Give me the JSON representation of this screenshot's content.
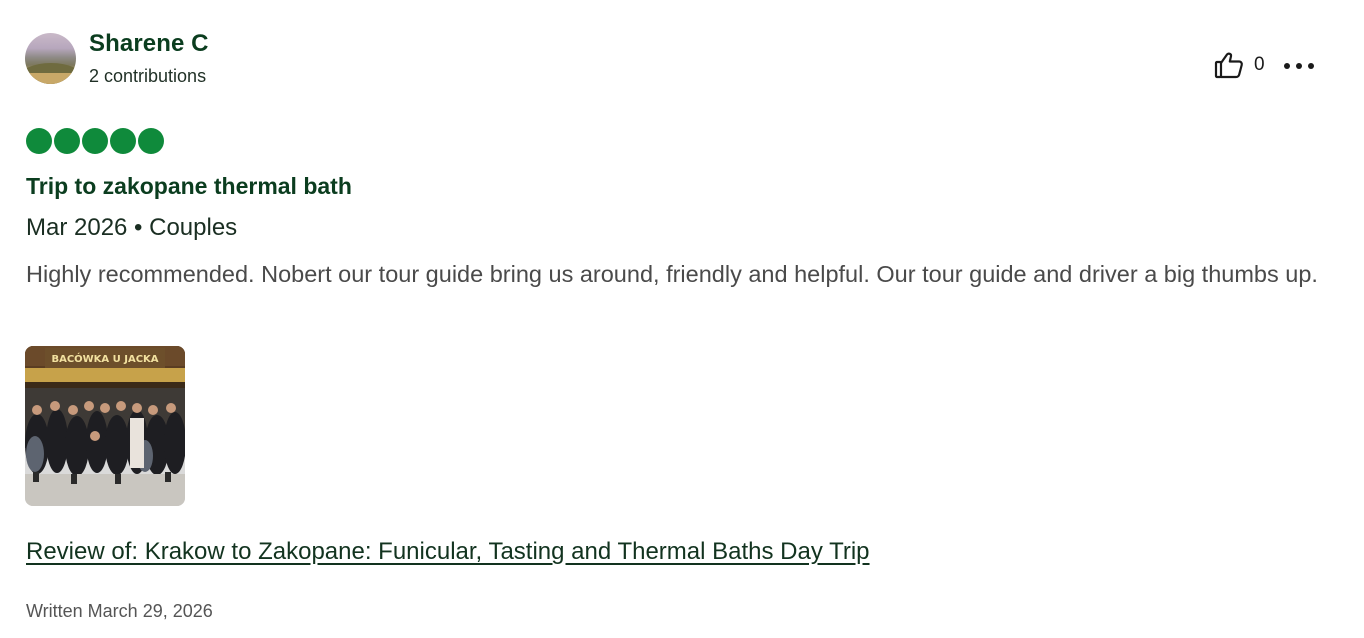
{
  "reviewer": {
    "name": "Sharene C",
    "contributions": "2 contributions"
  },
  "helpful": {
    "icon": "thumbs-up-icon",
    "count": "0"
  },
  "more_menu": {
    "icon": "more-dots-icon"
  },
  "rating": {
    "value": 5,
    "max": 5,
    "color": "#0f8a3b"
  },
  "review": {
    "title": "Trip to zakopane thermal bath",
    "meta": "Mar 2026 • Couples",
    "body": "Highly recommended. Nobert our tour guide bring us around, friendly and helpful. Our tour guide and driver a big thumbs up.",
    "photo_sign_text": "BACÓWKA U JACKA",
    "link_text": "Review of: Krakow to Zakopane: Funicular, Tasting and Thermal Baths Day Trip",
    "written_date": "Written March 29, 2026"
  },
  "colors": {
    "heading": "#0b3d1f",
    "rating_green": "#0f8a3b",
    "body_text": "#4a4a4a"
  }
}
